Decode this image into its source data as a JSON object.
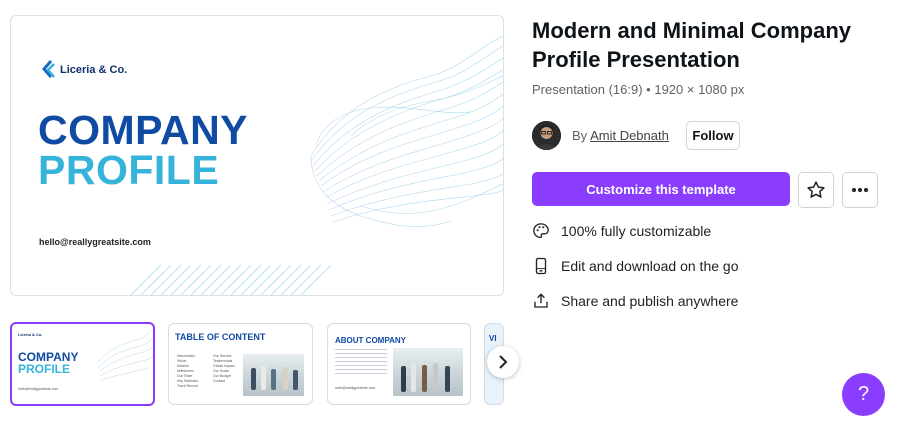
{
  "preview": {
    "logo_text": "Liceria & Co.",
    "title_line1": "COMPANY",
    "title_line2": "PROFILE",
    "email": "hello@reallygreatsite.com"
  },
  "thumbnails": [
    {
      "title_line1": "COMPANY",
      "title_line2": "PROFILE",
      "logo_text": "Liceria & Co.",
      "email": "hello@reallygreatsite.com"
    },
    {
      "title": "TABLE OF CONTENT",
      "items_left": [
        "Introduction",
        "Vision",
        "Mission",
        "Milestones",
        "Our Team",
        "Key Statistics",
        "Track Record"
      ],
      "items_right": [
        "Our Service",
        "Testimonials",
        "Global Impact",
        "Our Goals",
        "Our Budget",
        "Contact"
      ]
    },
    {
      "title": "ABOUT COMPANY",
      "email": "hello@reallygreatsite.com"
    },
    {
      "title": "VI"
    }
  ],
  "template": {
    "title": "Modern and Minimal Company Profile Presentation",
    "meta": "Presentation (16:9) • 1920 × 1080 px",
    "by_label": "By",
    "author": "Amit Debnath",
    "follow_label": "Follow",
    "cta_label": "Customize this template"
  },
  "features": [
    {
      "icon": "palette-icon",
      "label": "100% fully customizable"
    },
    {
      "icon": "phone-icon",
      "label": "Edit and download on the go"
    },
    {
      "icon": "share-icon",
      "label": "Share and publish anywhere"
    }
  ],
  "help_label": "?",
  "colors": {
    "accent": "#8b3dff",
    "navy": "#0f4aa3",
    "cyan": "#36b3da"
  }
}
